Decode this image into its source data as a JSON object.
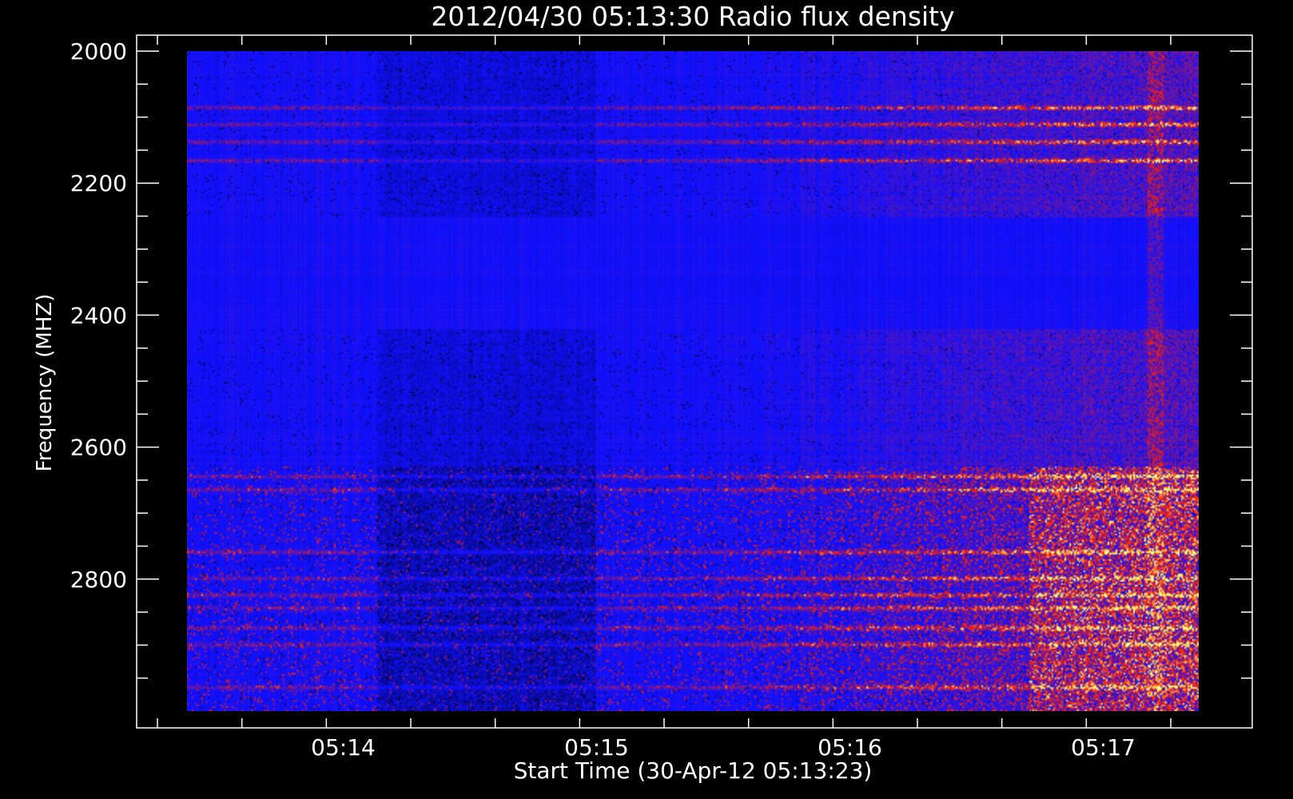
{
  "chart_data": {
    "type": "heatmap",
    "title": "2012/04/30 05:13:30 Radio flux density",
    "xlabel": "Start Time (30-Apr-12 05:13:23)",
    "ylabel": "Frequency (MHZ)",
    "x_ticks": [
      {
        "label": "05:14",
        "seconds": 37
      },
      {
        "label": "05:15",
        "seconds": 97
      },
      {
        "label": "05:16",
        "seconds": 157
      },
      {
        "label": "05:17",
        "seconds": 217
      }
    ],
    "y_ticks": [
      2000,
      2200,
      2400,
      2600,
      2800
    ],
    "ylim": [
      2000,
      3000
    ],
    "y_inverted": true,
    "data_time_range_seconds": [
      0,
      240
    ],
    "data_freq_range": [
      2000,
      3000
    ],
    "colormap": [
      "#000000",
      "#1010ff",
      "#ff2000",
      "#ffff80"
    ],
    "bright_bands_mhz": [
      2085,
      2110,
      2137,
      2165,
      2645,
      2665,
      2760,
      2800,
      2825,
      2845,
      2875,
      2900,
      2965
    ],
    "quiet_band_mhz": [
      2250,
      2420
    ],
    "dark_time_windows_seconds": [
      [
        45,
        97
      ]
    ],
    "active_time_window_seconds": [
      200,
      240
    ]
  }
}
